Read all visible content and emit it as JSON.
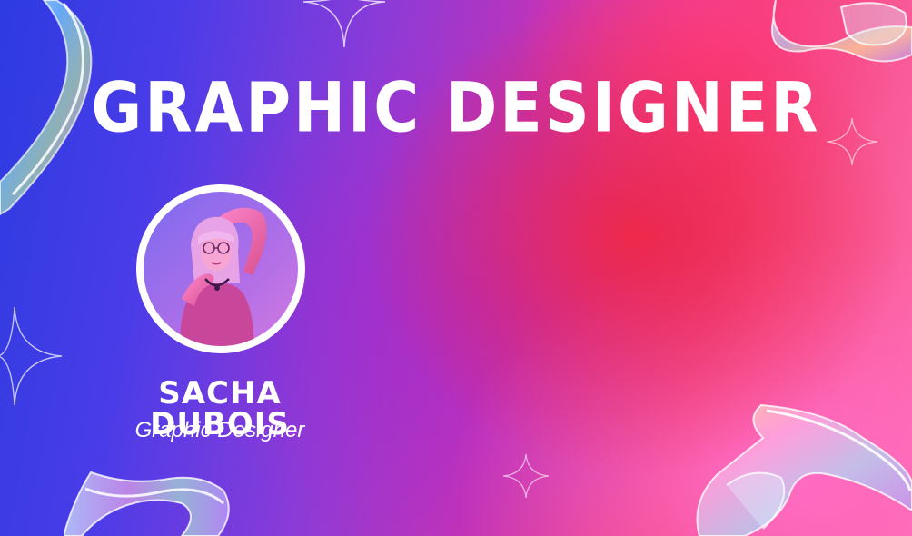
{
  "card": {
    "title": "GRAPHIC DESIGNER",
    "name": "SACHA DUBOIS",
    "role": "Graphic Designer"
  },
  "colors": {
    "text": "#ffffff",
    "gradient_left": "#2d3be0",
    "gradient_mid": "#c233b8",
    "gradient_right": "#ff6aa8"
  },
  "icons": {
    "stars": "sparkle-star-icon",
    "ribbons": "glass-ribbon-icon"
  }
}
